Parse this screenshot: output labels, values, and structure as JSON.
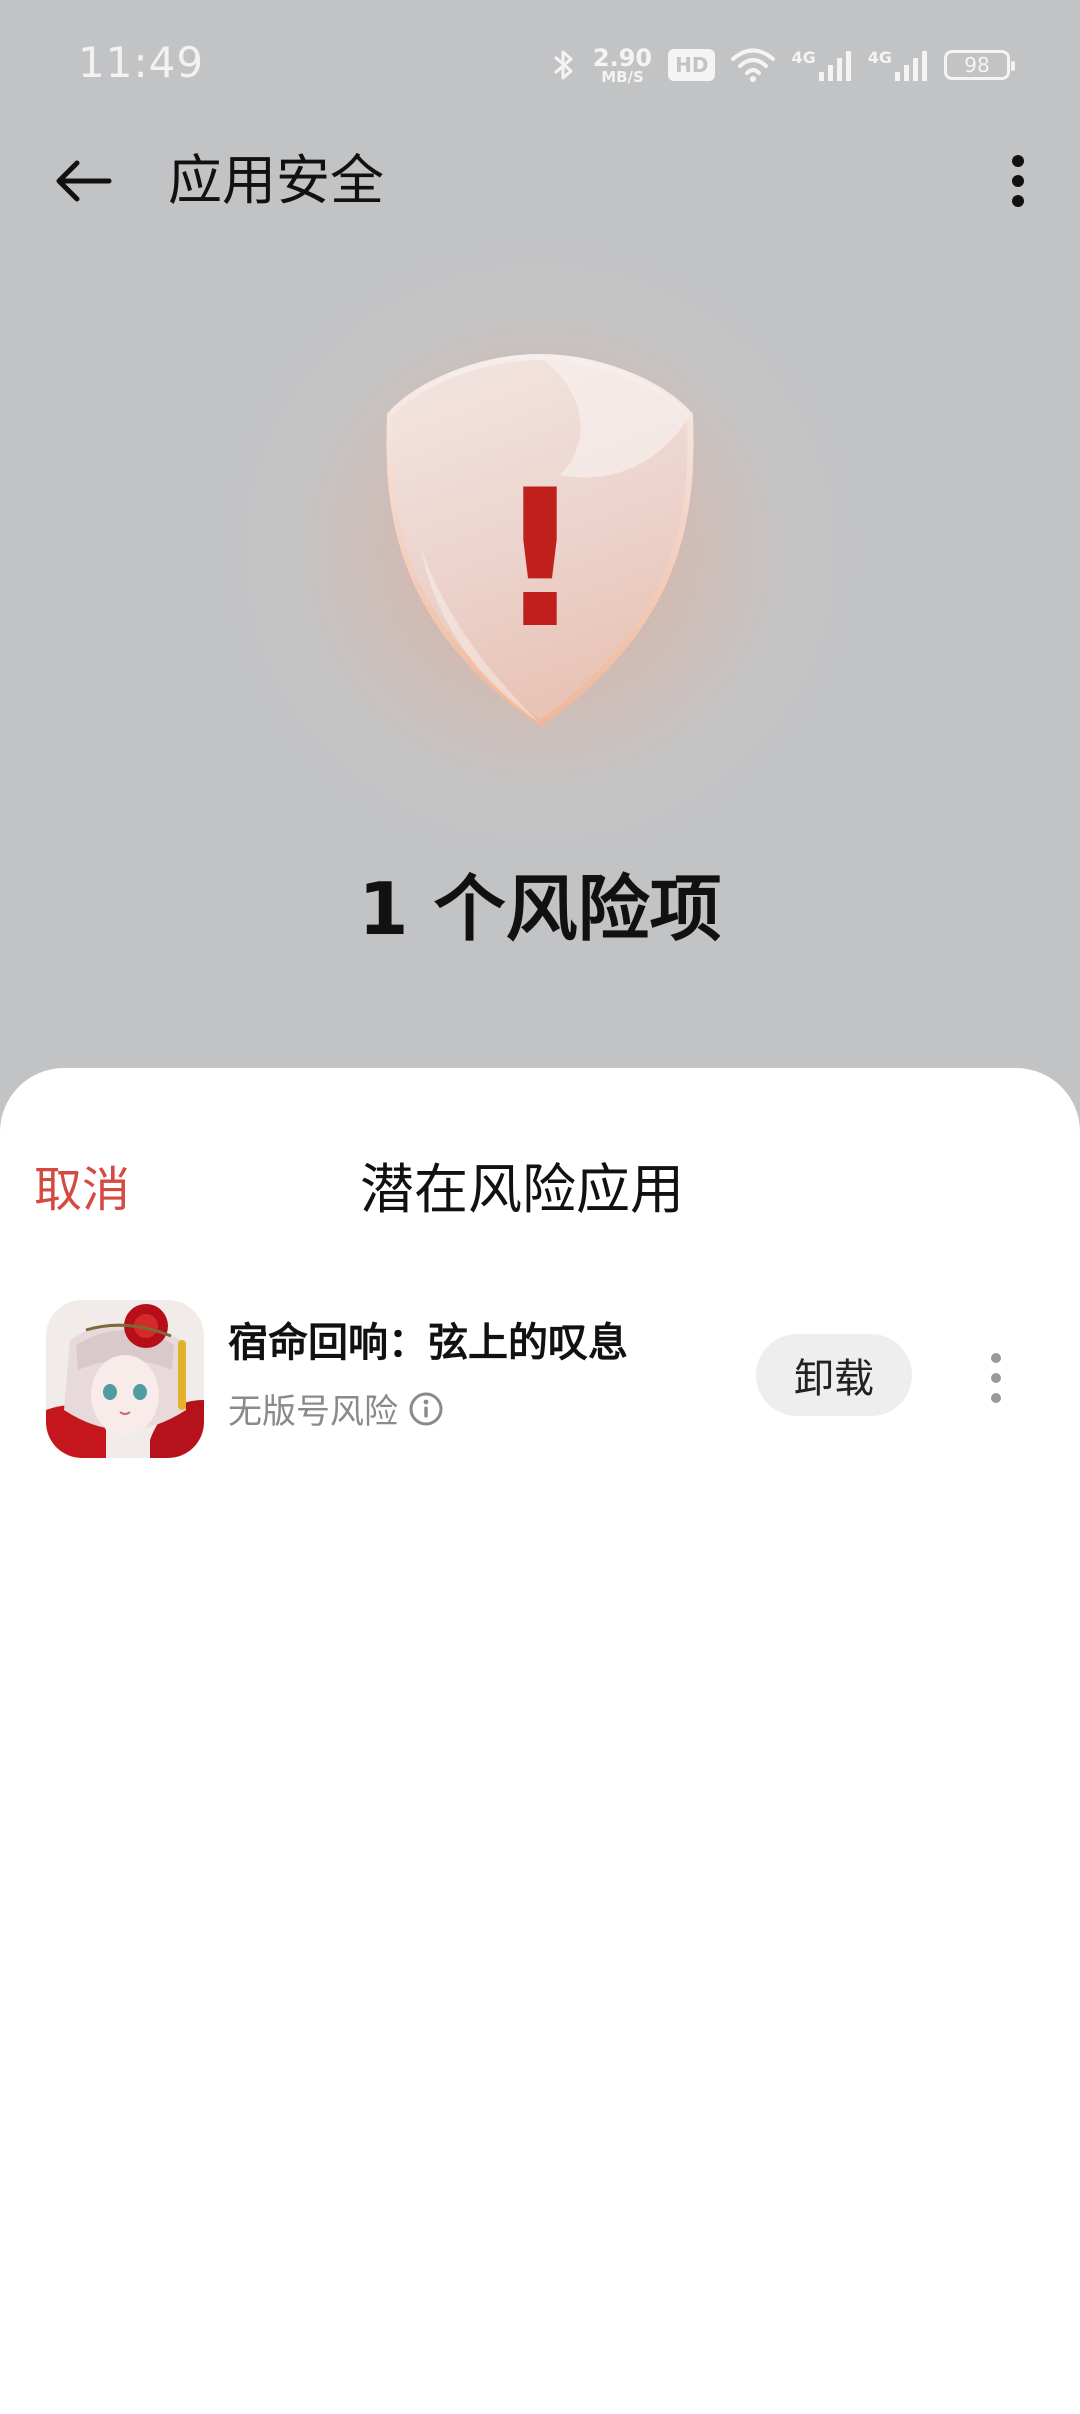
{
  "status_bar": {
    "time": "11:49",
    "net_speed_value": "2.90",
    "net_speed_unit": "MB/S",
    "hd_label": "HD",
    "signal_1_label": "4G",
    "signal_2_label": "4G",
    "battery_level": "98",
    "icons": [
      "bluetooth-icon",
      "wifi-icon",
      "signal-icon",
      "battery-icon"
    ]
  },
  "app_bar": {
    "title": "应用安全"
  },
  "hero": {
    "risk_summary": "1 个风险项",
    "shield_symbol": "!",
    "accent_color": "#c0201c"
  },
  "sheet": {
    "cancel_label": "取消",
    "title": "潜在风险应用",
    "apps": [
      {
        "name": "宿命回响：弦上的叹息",
        "risk_label": "无版号风险",
        "action_label": "卸载"
      }
    ]
  },
  "colors": {
    "background": "#c2c3c5",
    "cancel": "#d44a40",
    "sheet": "#ffffff",
    "button_bg": "#eeeeee"
  }
}
